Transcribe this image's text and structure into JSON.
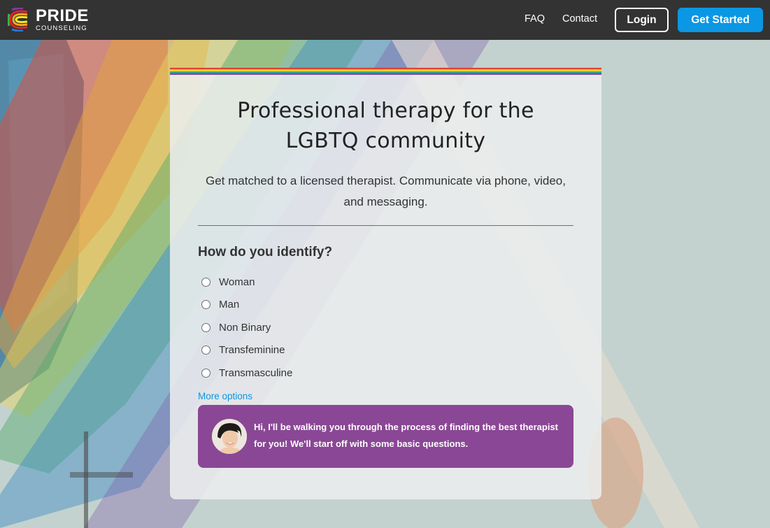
{
  "header": {
    "brand_title": "PRIDE",
    "brand_subtitle": "COUNSELING",
    "nav": {
      "faq": "FAQ",
      "contact": "Contact"
    },
    "login_label": "Login",
    "get_started_label": "Get Started"
  },
  "card": {
    "title_line1": "Professional therapy for the",
    "title_line2": "LGBTQ community",
    "subtitle_line1": "Get matched to a licensed therapist. Communicate via phone, video,",
    "subtitle_line2": "and messaging.",
    "question": "How do you identify?",
    "options": [
      "Woman",
      "Man",
      "Non Binary",
      "Transfeminine",
      "Transmasculine"
    ],
    "more_options": "More options",
    "assistant_message_line1": "Hi, I'll be walking you through the process of finding the best therapist",
    "assistant_message_line2": "for you! We'll start off with some basic questions."
  },
  "colors": {
    "header_bg": "#333333",
    "accent_blue": "#0b97e3",
    "bubble_purple": "#8a4795",
    "divider_purple": "#7b57c8",
    "rainbow": [
      "#e2212c",
      "#f5a623",
      "#f8e71c",
      "#3db54a",
      "#1b7fd6",
      "#7a3fa0"
    ]
  }
}
